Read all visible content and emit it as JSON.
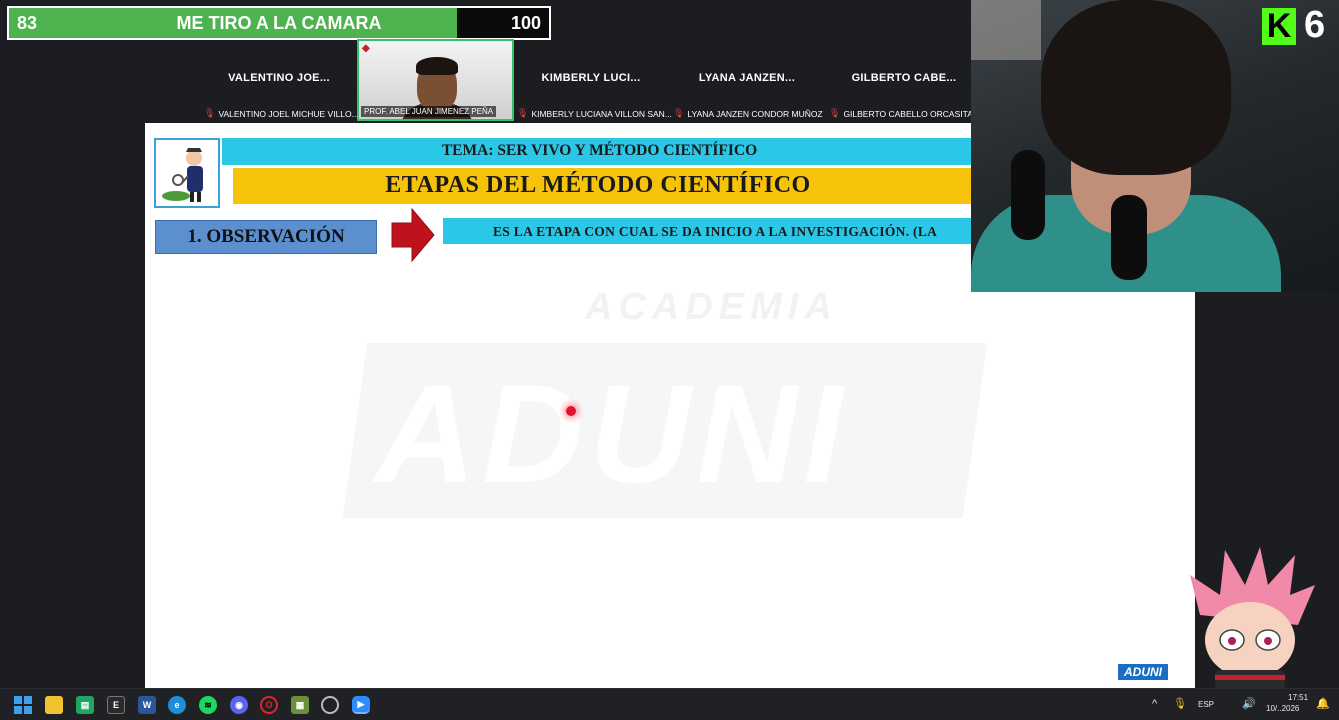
{
  "progress_overlay": {
    "current": "83",
    "title": "ME TIRO A LA CAMARA",
    "goal": "100",
    "fill_fraction": 0.83
  },
  "participants": {
    "short_names": [
      "VALENTINO JOE...",
      "KIMBERLY LUCI...",
      "LYANA JANZEN...",
      "GILBERTO CABE..."
    ],
    "full_names": [
      "VALENTINO JOEL MICHUE VILLO...",
      "KIMBERLY LUCIANA VILLON SAN...",
      "LYANA JANZEN CONDOR MUÑOZ",
      "GILBERTO CABELLO ORCASITAS"
    ],
    "active_speaker": "PROF. ABEL JUAN JIMENEZ PEÑA"
  },
  "slide": {
    "tema": "TEMA: SER VIVO Y MÉTODO CIENTÍFICO",
    "heading": "ETAPAS DEL MÉTODO CIENTÍFICO",
    "step": "1. OBSERVACIÓN",
    "definition": "ES LA ETAPA CON CUAL SE DA INICIO A LA INVESTIGACIÓN. (LA",
    "watermark_top": "ACADEMIA",
    "watermark_main": "ADUNI",
    "corner_badge": "ADUNI"
  },
  "stream": {
    "platform_icon": "kick-icon",
    "viewer_count": "6",
    "brand_color": "#53fc18"
  },
  "taskbar": {
    "apps": [
      "windows-start-icon",
      "file-explorer-icon",
      "sheets-icon",
      "epic-games-icon",
      "word-icon",
      "edge-icon",
      "spotify-icon",
      "discord-icon",
      "opera-gx-icon",
      "minecraft-icon",
      "chrome-icon",
      "zoom-icon"
    ],
    "tray": {
      "language": "ESP",
      "time": "17:51",
      "date": "10/..2026"
    }
  }
}
